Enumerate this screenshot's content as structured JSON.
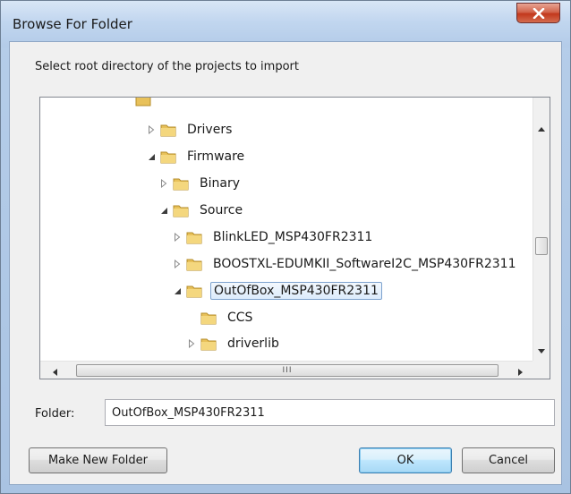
{
  "window": {
    "title": "Browse For Folder"
  },
  "dialog": {
    "instruction": "Select root directory of the projects to import"
  },
  "tree": {
    "rows": [
      {
        "label": "Drivers",
        "state": "collapsed"
      },
      {
        "label": "Firmware",
        "state": "expanded"
      },
      {
        "label": "Binary",
        "state": "collapsed"
      },
      {
        "label": "Source",
        "state": "expanded"
      },
      {
        "label": "BlinkLED_MSP430FR2311",
        "state": "collapsed"
      },
      {
        "label": "BOOSTXL-EDUMKII_SoftwareI2C_MSP430FR2311",
        "state": "collapsed"
      },
      {
        "label": "OutOfBox_MSP430FR2311",
        "state": "expanded",
        "selected": true
      },
      {
        "label": "CCS",
        "state": "leaf"
      },
      {
        "label": "driverlib",
        "state": "collapsed"
      }
    ],
    "hscroll_grip": "III"
  },
  "folder": {
    "label": "Folder:",
    "value": "OutOfBox_MSP430FR2311"
  },
  "buttons": {
    "make_new_folder": "Make New Folder",
    "ok": "OK",
    "cancel": "Cancel"
  },
  "colors": {
    "folder_yellow": "#e8c15a",
    "selection_border": "#7da2ce",
    "close_red": "#c2381c"
  },
  "icons": {
    "close": "close-icon",
    "folder": "folder-icon",
    "expander_collapsed": "chevron-right-outline-icon",
    "expander_expanded": "chevron-down-filled-icon"
  }
}
